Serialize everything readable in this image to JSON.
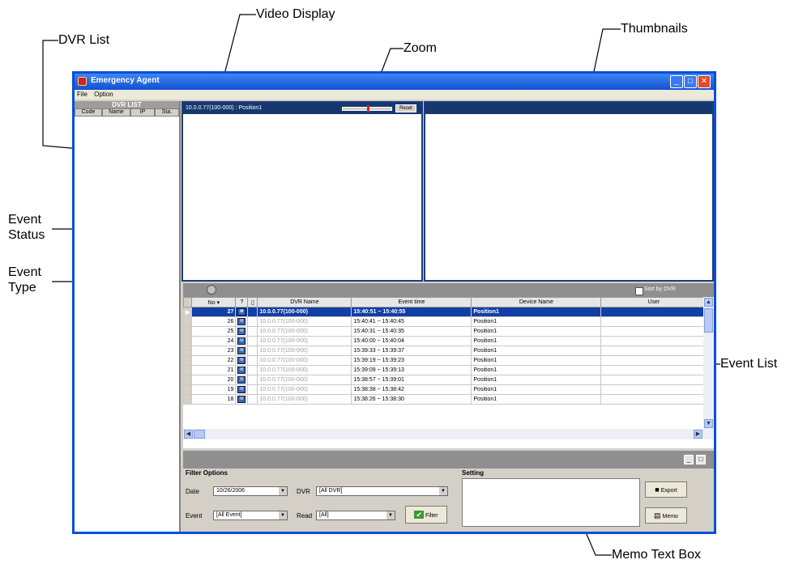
{
  "callouts": {
    "dvr_list": "DVR List",
    "video_display": "Video Display",
    "zoom": "Zoom",
    "thumbnails": "Thumbnails",
    "event_status": "Event\nStatus",
    "event_type": "Event\nType",
    "event_list": "Event List",
    "memo_text_box": "Memo Text Box"
  },
  "window": {
    "title": "Emergency Agent",
    "menu": [
      "File",
      "Option"
    ]
  },
  "dvr_list": {
    "header": "DVR LIST",
    "columns": [
      "Code",
      "Name",
      "IP",
      "Sta."
    ]
  },
  "video": {
    "caption": "10.0.0.77(100-000) : Position1",
    "reset_label": "Reset"
  },
  "event_list": {
    "sort_label": "Sort by DVR",
    "columns": [
      "No ▾",
      "?",
      "",
      "DVR Name",
      "Event time",
      "Device Name",
      "User"
    ],
    "rows": [
      {
        "no": "27",
        "dvr": "10.0.0.77(100-000)",
        "time": "15:40:51 ~ 15:40:55",
        "device": "Position1",
        "selected": true
      },
      {
        "no": "26",
        "dvr": "10.0.0.77(100-000)",
        "time": "15:40:41 ~ 15:40:45",
        "device": "Position1"
      },
      {
        "no": "25",
        "dvr": "10.0.0.77(100-000)",
        "time": "15:40:31 ~ 15:40:35",
        "device": "Position1"
      },
      {
        "no": "24",
        "dvr": "10.0.0.77(100-000)",
        "time": "15:40:00 ~ 15:40:04",
        "device": "Position1"
      },
      {
        "no": "23",
        "dvr": "10.0.0.77(100-000)",
        "time": "15:39:33 ~ 15:39:37",
        "device": "Position1"
      },
      {
        "no": "22",
        "dvr": "10.0.0.77(100-000)",
        "time": "15:39:19 ~ 15:39:23",
        "device": "Position1"
      },
      {
        "no": "21",
        "dvr": "10.0.0.77(100-000)",
        "time": "15:39:09 ~ 15:39:13",
        "device": "Position1"
      },
      {
        "no": "20",
        "dvr": "10.0.0.77(100-000)",
        "time": "15:38:57 ~ 15:39:01",
        "device": "Position1"
      },
      {
        "no": "19",
        "dvr": "10.0.0.77(100-000)",
        "time": "15:38:38 ~ 15:38:42",
        "device": "Position1"
      },
      {
        "no": "18",
        "dvr": "10.0.0.77(100-000)",
        "time": "15:38:26 ~ 15:38:30",
        "device": "Position1"
      }
    ]
  },
  "filter": {
    "title": "Filter Options",
    "date_label": "Date",
    "date_value": "10/26/2006",
    "dvr_label": "DVR",
    "dvr_value": "[All DVR]",
    "event_label": "Event",
    "event_value": "[All Event]",
    "read_label": "Read",
    "read_value": "[All]",
    "filter_button": "Filter"
  },
  "setting": {
    "title": "Setting",
    "export_button": "Export",
    "memo_button": "Memo"
  }
}
